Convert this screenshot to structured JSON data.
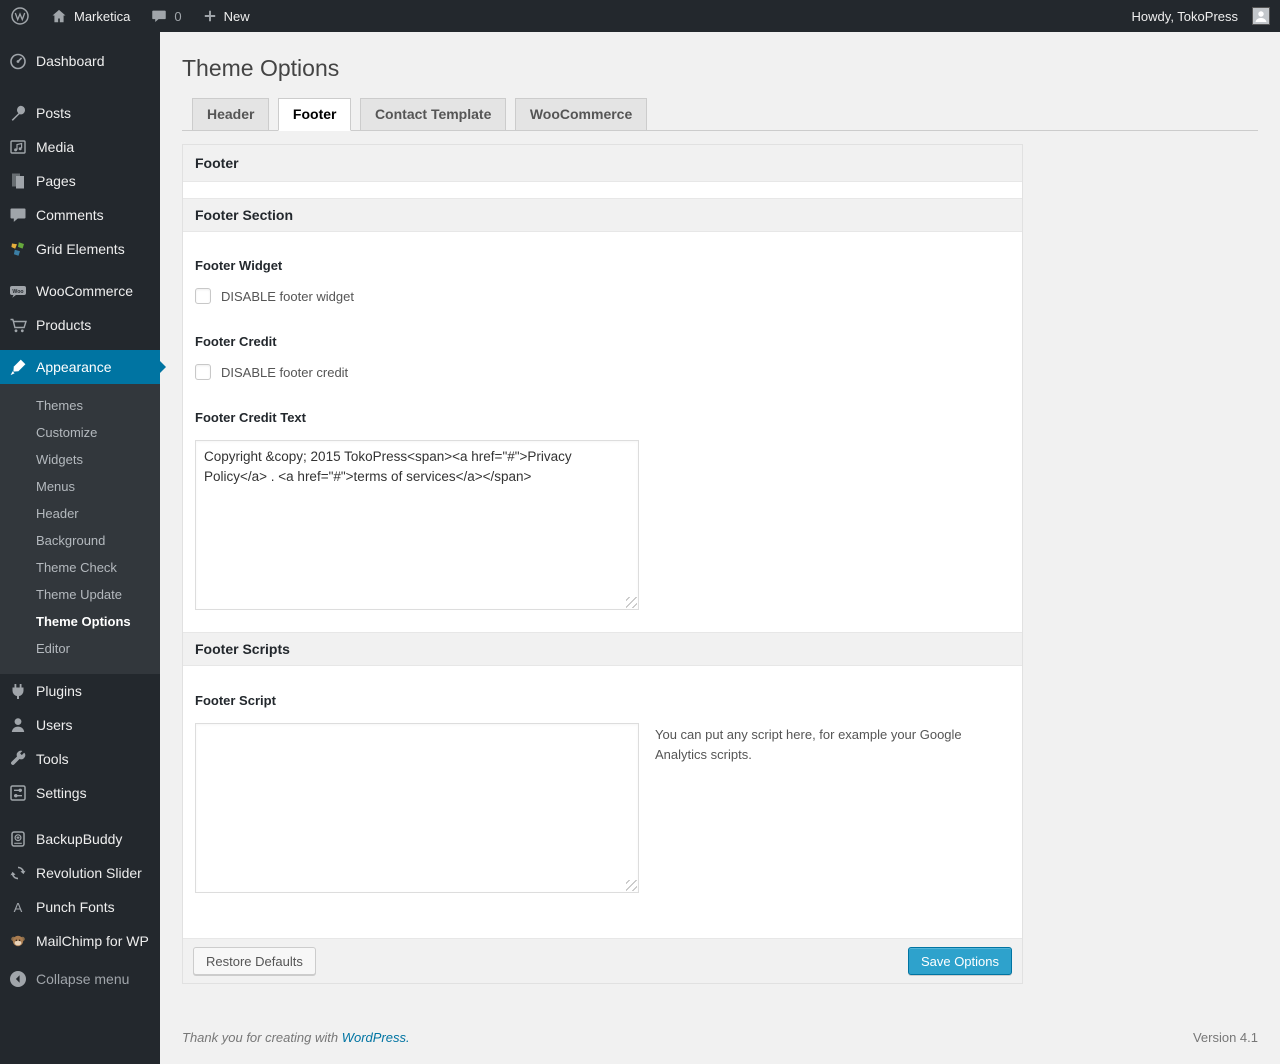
{
  "admin_bar": {
    "site_name": "Marketica",
    "comments_count": "0",
    "new_label": "New",
    "howdy": "Howdy, TokoPress"
  },
  "sidebar": {
    "items": [
      {
        "icon": "dashboard-icon",
        "label": "Dashboard"
      },
      {
        "icon": "pin-icon",
        "label": "Posts"
      },
      {
        "icon": "media-icon",
        "label": "Media"
      },
      {
        "icon": "pages-icon",
        "label": "Pages"
      },
      {
        "icon": "comments-icon",
        "label": "Comments"
      },
      {
        "icon": "grid-elements-icon",
        "label": "Grid Elements"
      },
      {
        "icon": "woocommerce-icon",
        "label": "WooCommerce"
      },
      {
        "icon": "cart-icon",
        "label": "Products"
      },
      {
        "icon": "appearance-icon",
        "label": "Appearance",
        "active": true
      },
      {
        "icon": "plugins-icon",
        "label": "Plugins"
      },
      {
        "icon": "users-icon",
        "label": "Users"
      },
      {
        "icon": "tools-icon",
        "label": "Tools"
      },
      {
        "icon": "settings-icon",
        "label": "Settings"
      },
      {
        "icon": "backupbuddy-icon",
        "label": "BackupBuddy"
      },
      {
        "icon": "revolution-slider-icon",
        "label": "Revolution Slider"
      },
      {
        "icon": "punch-fonts-icon",
        "label": "Punch Fonts"
      },
      {
        "icon": "mailchimp-icon",
        "label": "MailChimp for WP"
      },
      {
        "icon": "collapse-icon",
        "label": "Collapse menu"
      }
    ],
    "appearance_submenu": [
      "Themes",
      "Customize",
      "Widgets",
      "Menus",
      "Header",
      "Background",
      "Theme Check",
      "Theme Update",
      "Theme Options",
      "Editor"
    ],
    "current_submenu_item": "Theme Options"
  },
  "main": {
    "page_title": "Theme Options",
    "tabs": [
      {
        "label": "Header",
        "active": false
      },
      {
        "label": "Footer",
        "active": true
      },
      {
        "label": "Contact Template",
        "active": false
      },
      {
        "label": "WooCommerce",
        "active": false
      }
    ],
    "panel": {
      "title_bar": "Footer",
      "section_title": "Footer Section",
      "footer_widget_label": "Footer Widget",
      "footer_widget_checkbox": "DISABLE footer widget",
      "footer_widget_checked": false,
      "footer_credit_label": "Footer Credit",
      "footer_credit_checkbox": "DISABLE footer credit",
      "footer_credit_checked": false,
      "footer_credit_text_label": "Footer Credit Text",
      "footer_credit_text_value": "Copyright &copy; 2015 TokoPress<span><a href=\"#\">Privacy Policy</a> . <a href=\"#\">terms of services</a></span>",
      "scripts_section_title": "Footer Scripts",
      "footer_script_label": "Footer Script",
      "footer_script_value": "",
      "footer_script_helper": "You can put any script here, for example your Google Analytics scripts.",
      "restore_button": "Restore Defaults",
      "save_button": "Save Options"
    }
  },
  "page_footer": {
    "thanks_prefix": "Thank you for creating with ",
    "wordpress_link": "WordPress.",
    "version": "Version 4.1"
  },
  "colors": {
    "accent": "#0074a2",
    "primary_button": "#2ea2cc",
    "admin_bar_bg": "#23282d",
    "submenu_bg": "#32373c",
    "page_bg": "#f1f1f1",
    "link": "#0074a2"
  }
}
